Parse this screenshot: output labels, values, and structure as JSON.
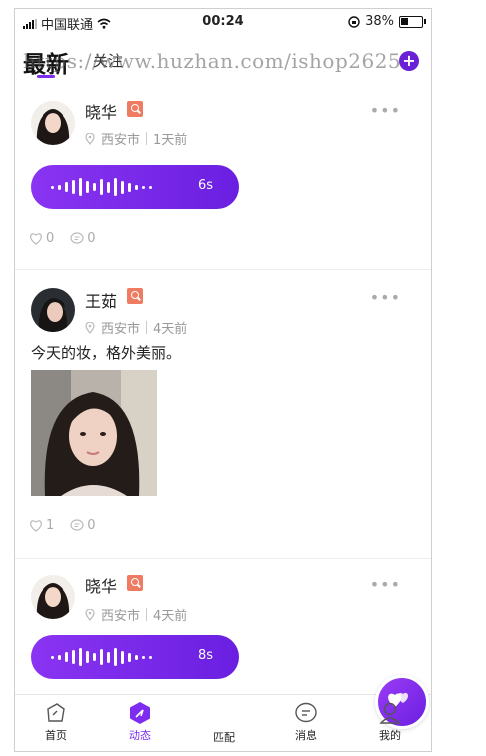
{
  "status_bar": {
    "carrier": "中国联通",
    "time": "00:24",
    "battery": "38%",
    "battery_level": 0.38
  },
  "header": {
    "tab_latest": "最新",
    "tab_follow": "关注",
    "watermark": "https://www.huzhan.com/ishop26250"
  },
  "posts": [
    {
      "name": "晓华",
      "city": "西安市",
      "time": "1天前",
      "voice_duration": "6s",
      "likes": "0",
      "comments": "0"
    },
    {
      "name": "王茹",
      "city": "西安市",
      "time": "4天前",
      "text": "今天的妆，格外美丽。",
      "likes": "1",
      "comments": "0"
    },
    {
      "name": "晓华",
      "city": "西安市",
      "time": "4天前",
      "voice_duration": "8s"
    }
  ],
  "tabbar": {
    "home": "首页",
    "moments": "动态",
    "match": "匹配",
    "messages": "消息",
    "mine": "我的"
  },
  "colors": {
    "accent": "#7d2cf0",
    "tag": "#ef7b62"
  }
}
